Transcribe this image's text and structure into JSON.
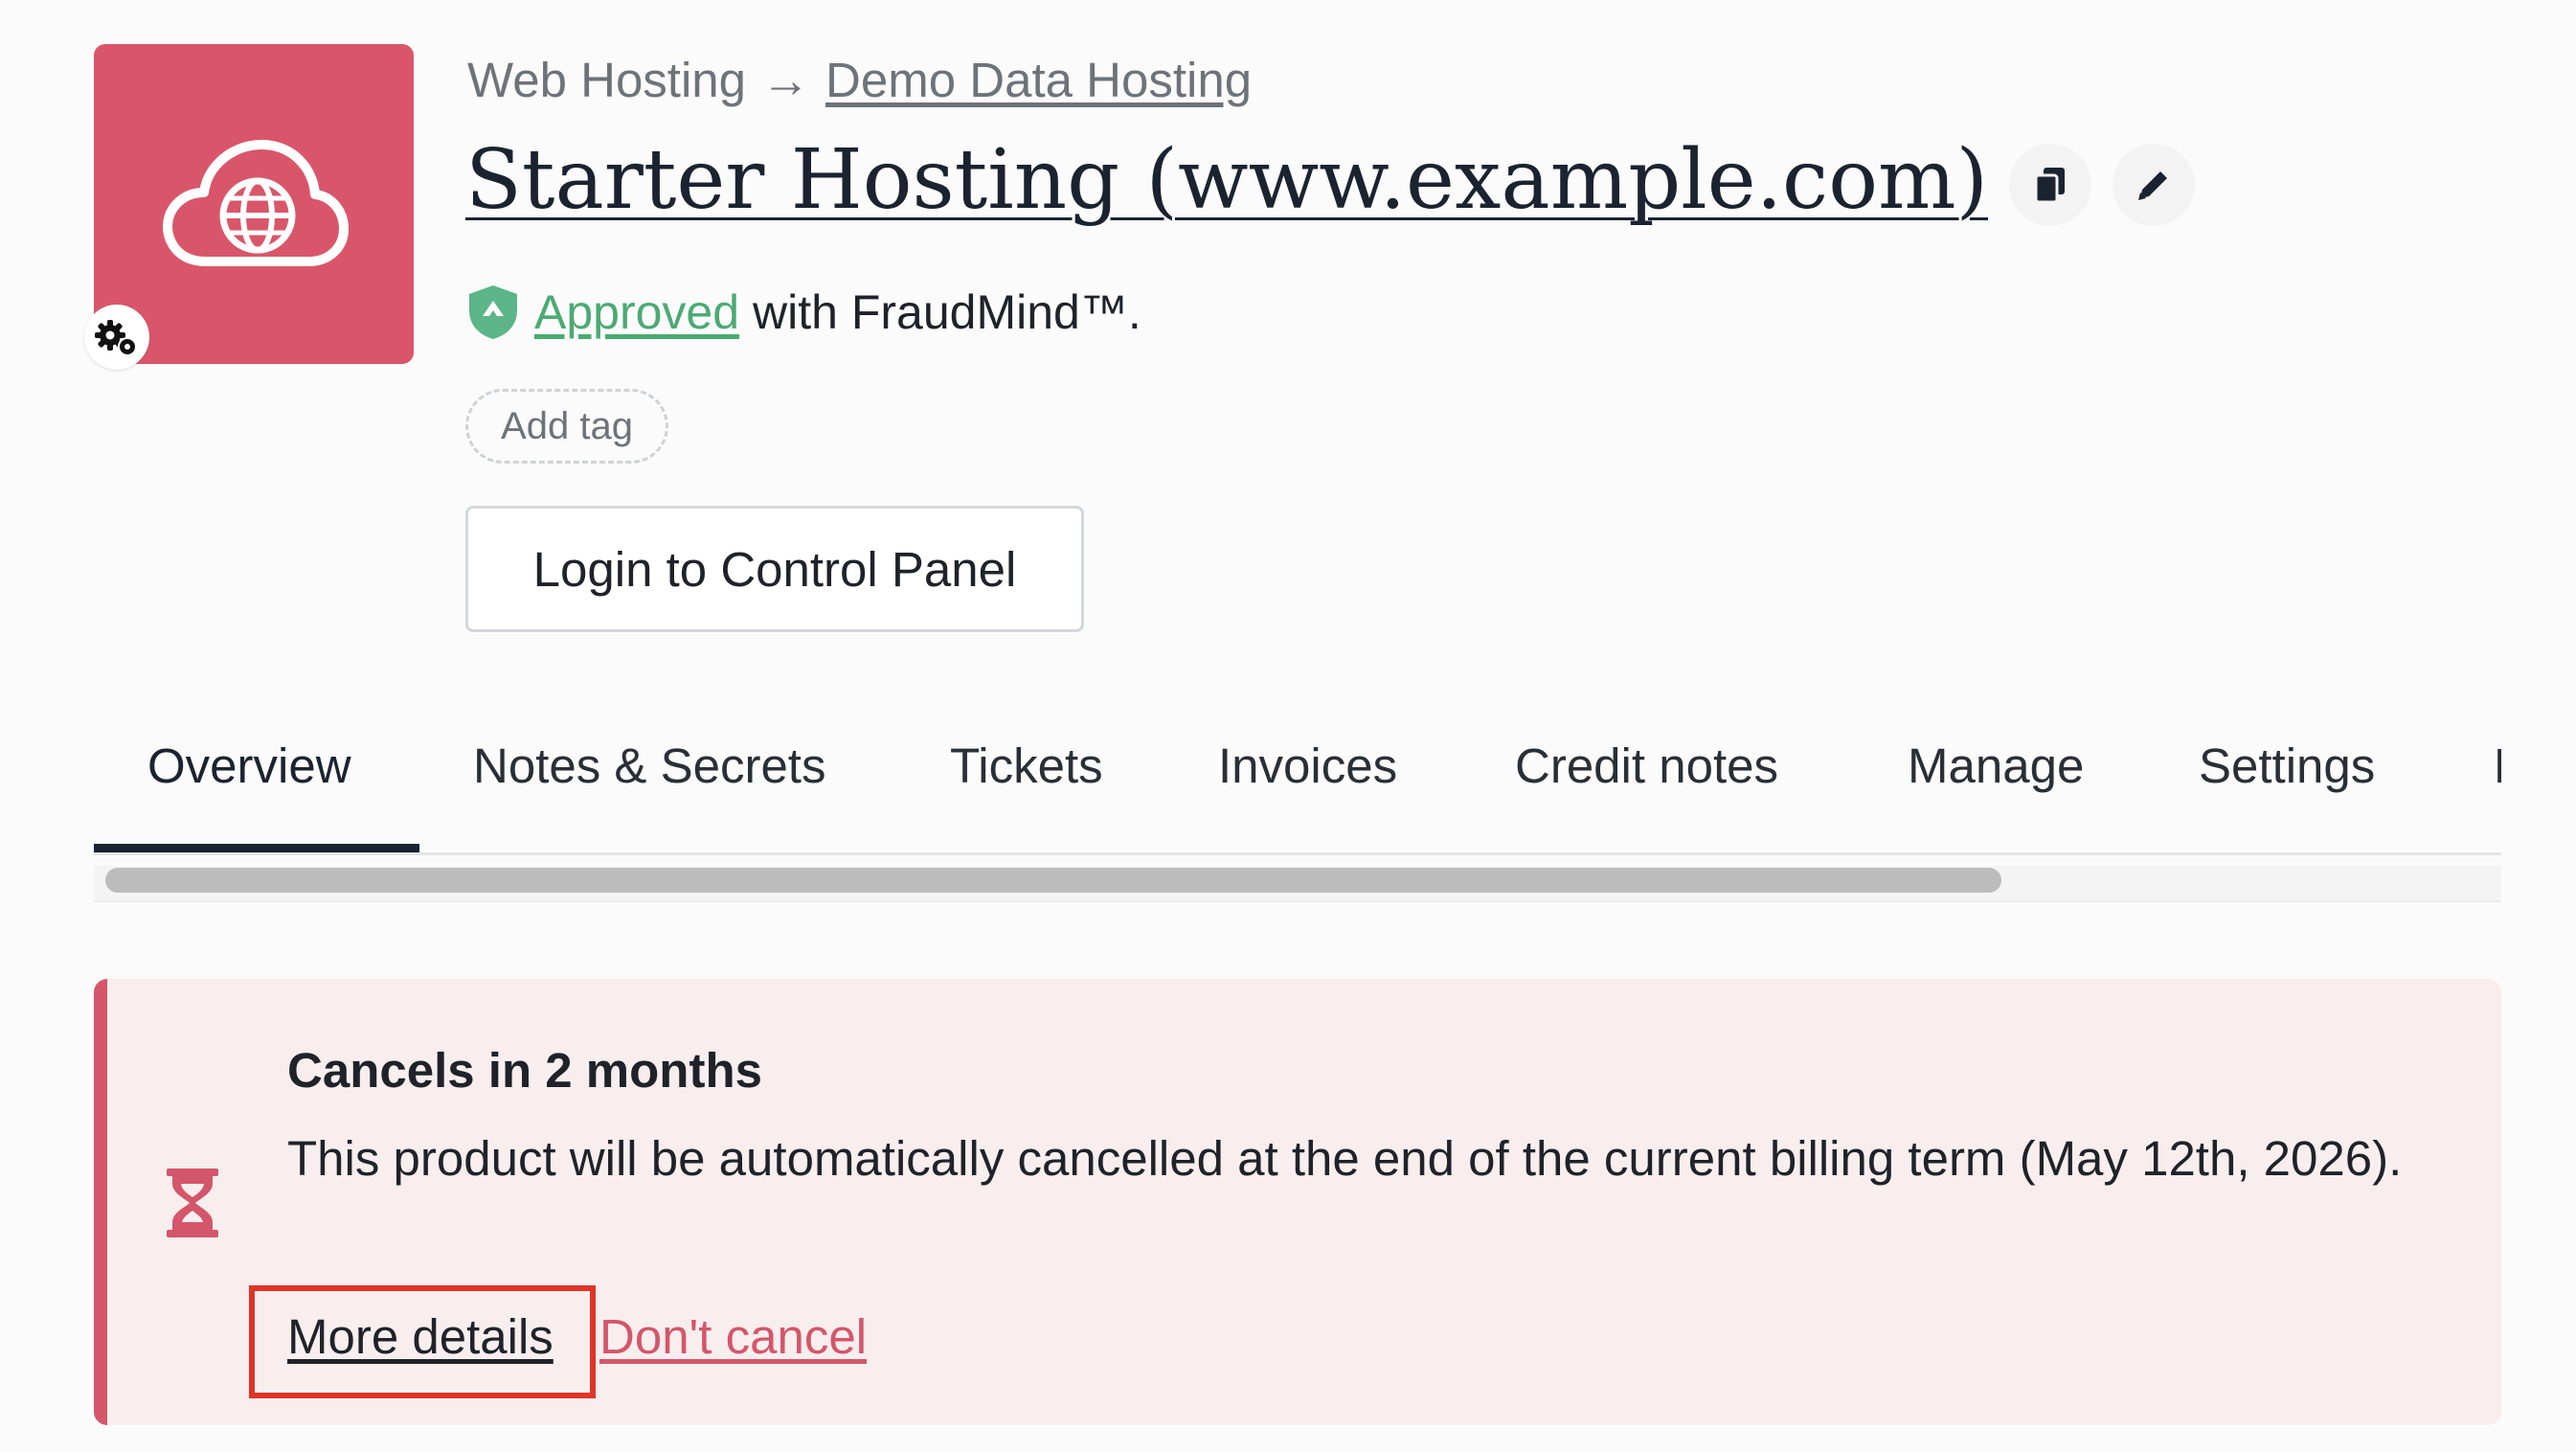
{
  "colors": {
    "brand": "#d9566a",
    "approved_green": "#4caa73",
    "alert_accent": "#d4566a",
    "alert_bg": "#f8eeee",
    "highlight": "#e03428"
  },
  "product": {
    "image_icon": "cloud-globe-icon",
    "badge_icon": "gear-icon"
  },
  "breadcrumb": {
    "parent": "Web Hosting",
    "separator": "→",
    "current": "Demo Data Hosting"
  },
  "title": "Starter Hosting (www.example.com)",
  "title_actions": {
    "copy_icon": "copy-icon",
    "edit_icon": "pencil-icon"
  },
  "fraud": {
    "status_link": "Approved",
    "suffix": "with FraudMind™."
  },
  "tag": {
    "add_label": "Add tag"
  },
  "login_button": "Login to Control Panel",
  "tabs": [
    {
      "label": "Overview",
      "active": true
    },
    {
      "label": "Notes & Secrets"
    },
    {
      "label": "Tickets"
    },
    {
      "label": "Invoices"
    },
    {
      "label": "Credit notes"
    },
    {
      "label": "Manage"
    },
    {
      "label": "Settings"
    },
    {
      "label": "D"
    }
  ],
  "alert": {
    "icon": "hourglass-icon",
    "title": "Cancels in 2 months",
    "body": "This product will be automatically cancelled at the end of the current billing term (May 12th, 2026).",
    "more_details": "More details",
    "dont_cancel": "Don't cancel"
  }
}
